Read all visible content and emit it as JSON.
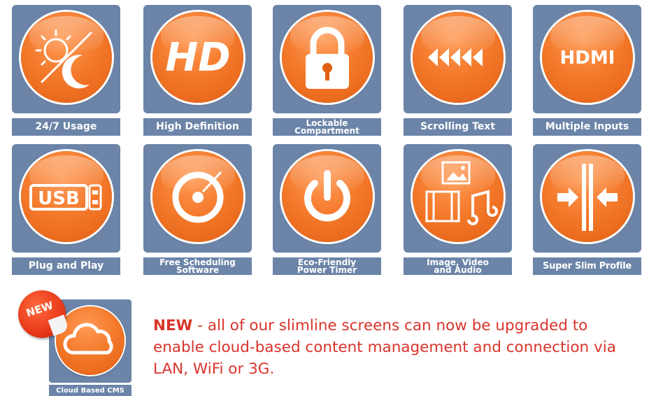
{
  "features": [
    {
      "label": "24/7 Usage",
      "icon": "sun-moon-icon"
    },
    {
      "label": "High Definition",
      "icon": "hd-icon",
      "icon_text": "HD"
    },
    {
      "label": "Lockable\nCompartment",
      "icon": "padlock-icon"
    },
    {
      "label": "Scrolling Text",
      "icon": "scrolling-arrows-icon"
    },
    {
      "label": "Multiple Inputs",
      "icon": "hdmi-icon",
      "icon_text": "HDMI"
    },
    {
      "label": "Plug and Play",
      "icon": "usb-icon",
      "icon_text": "USB"
    },
    {
      "label": "Free Scheduling\nSoftware",
      "icon": "disc-icon"
    },
    {
      "label": "Eco-Friendly\nPower Timer",
      "icon": "power-icon"
    },
    {
      "label": "Image, Video\nand Audio",
      "icon": "media-icon"
    },
    {
      "label": "Super Slim Profile",
      "icon": "slim-profile-icon"
    }
  ],
  "cms": {
    "label": "Cloud Based CMS",
    "icon": "cloud-icon",
    "badge": "NEW"
  },
  "note": {
    "bold": "NEW",
    "text": " - all of our slimline screens can now be upgraded to enable cloud-based content management and connection via LAN, WiFi or 3G."
  },
  "colors": {
    "tile": "#6b84a8",
    "orange": "#f47a2c",
    "note": "#d9342b",
    "badge": "#e8391a"
  }
}
